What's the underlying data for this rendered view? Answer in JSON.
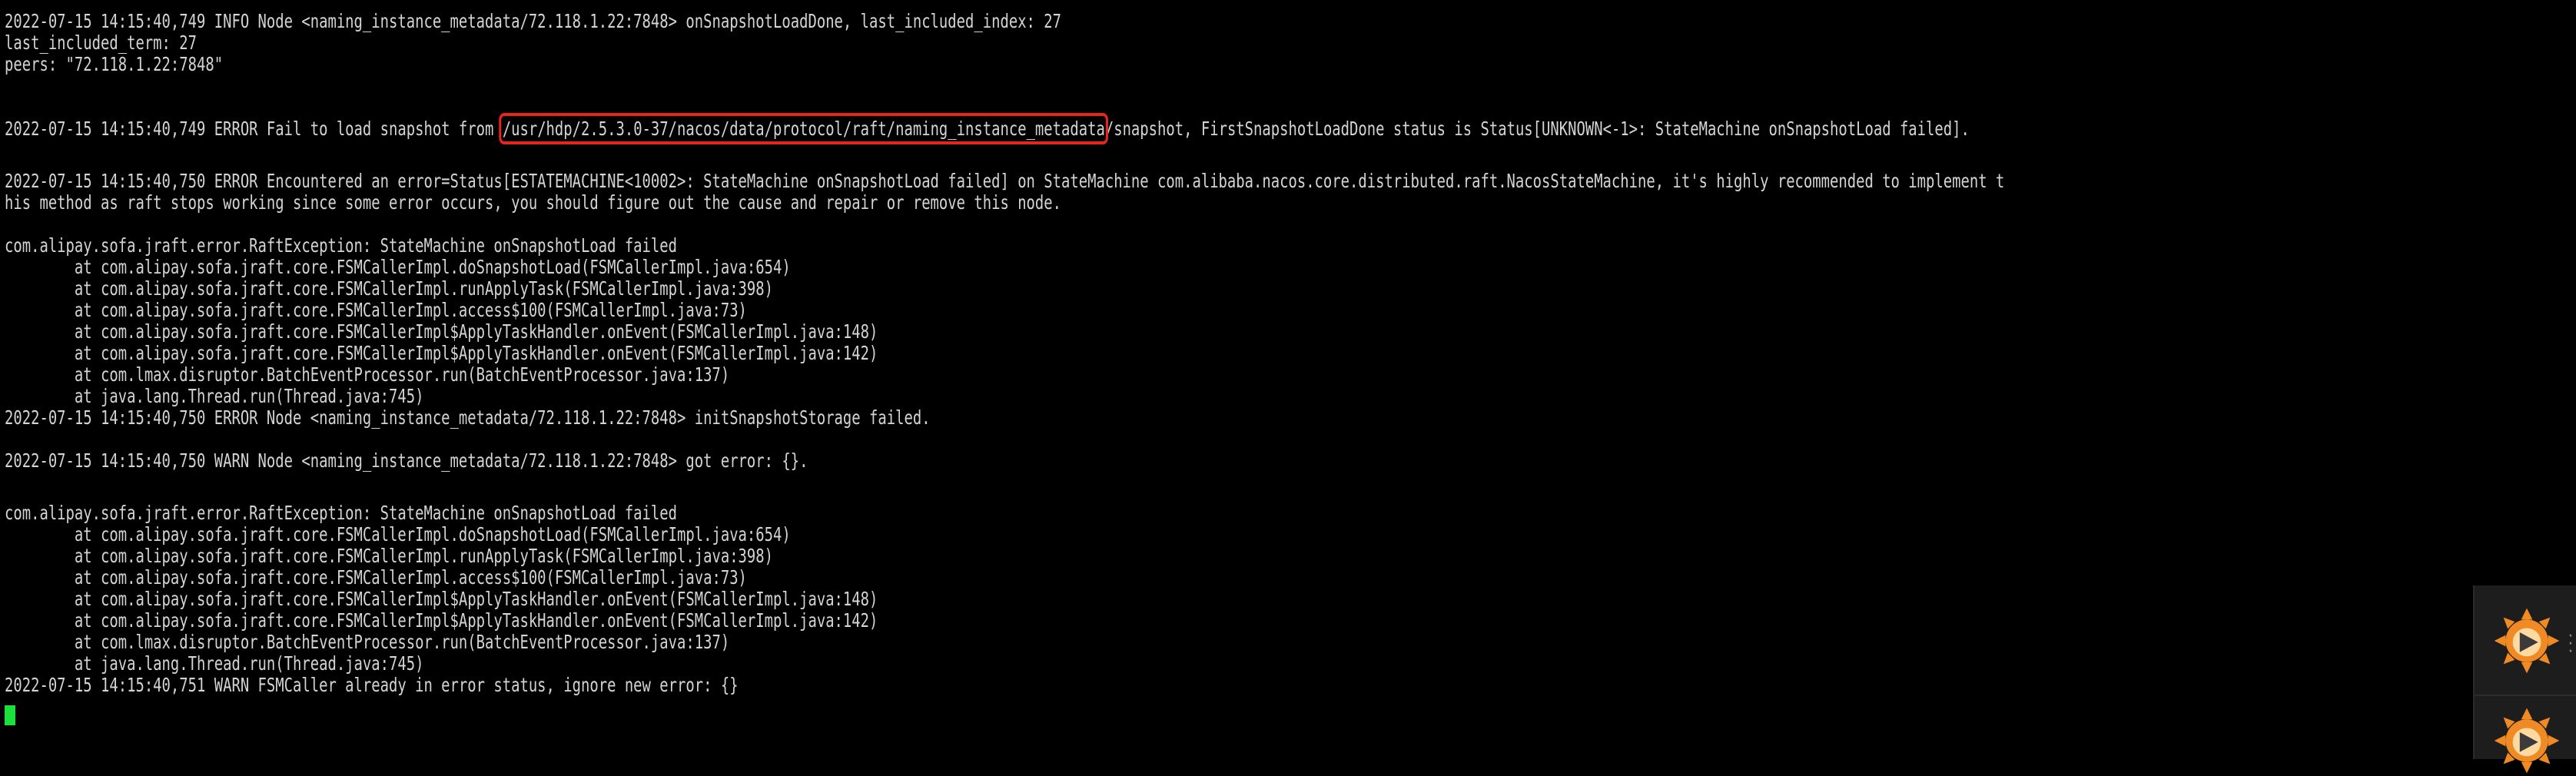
{
  "terminal": {
    "lines": [
      "2022-07-15 14:15:40,749 INFO Node <naming_instance_metadata/72.118.1.22:7848> onSnapshotLoadDone, last_included_index: 27",
      "last_included_term: 27",
      "peers: \"72.118.1.22:7848\"",
      "",
      "",
      "",
      "",
      "2022-07-15 14:15:40,750 ERROR Encountered an error=Status[ESTATEMACHINE<10002>: StateMachine onSnapshotLoad failed] on StateMachine com.alibaba.nacos.core.distributed.raft.NacosStateMachine, it's highly recommended to implement t",
      "his method as raft stops working since some error occurs, you should figure out the cause and repair or remove this node.",
      "",
      "com.alipay.sofa.jraft.error.RaftException: StateMachine onSnapshotLoad failed",
      "        at com.alipay.sofa.jraft.core.FSMCallerImpl.doSnapshotLoad(FSMCallerImpl.java:654)",
      "        at com.alipay.sofa.jraft.core.FSMCallerImpl.runApplyTask(FSMCallerImpl.java:398)",
      "        at com.alipay.sofa.jraft.core.FSMCallerImpl.access$100(FSMCallerImpl.java:73)",
      "        at com.alipay.sofa.jraft.core.FSMCallerImpl$ApplyTaskHandler.onEvent(FSMCallerImpl.java:148)",
      "        at com.alipay.sofa.jraft.core.FSMCallerImpl$ApplyTaskHandler.onEvent(FSMCallerImpl.java:142)",
      "        at com.lmax.disruptor.BatchEventProcessor.run(BatchEventProcessor.java:137)",
      "        at java.lang.Thread.run(Thread.java:745)",
      "2022-07-15 14:15:40,750 ERROR Node <naming_instance_metadata/72.118.1.22:7848> initSnapshotStorage failed.",
      "",
      "2022-07-15 14:15:40,750 WARN Node <naming_instance_metadata/72.118.1.22:7848> got error: {}.",
      "",
      "com.alipay.sofa.jraft.error.RaftException: StateMachine onSnapshotLoad failed",
      "        at com.alipay.sofa.jraft.core.FSMCallerImpl.doSnapshotLoad(FSMCallerImpl.java:654)",
      "        at com.alipay.sofa.jraft.core.FSMCallerImpl.runApplyTask(FSMCallerImpl.java:398)",
      "        at com.alipay.sofa.jraft.core.FSMCallerImpl.access$100(FSMCallerImpl.java:73)",
      "        at com.alipay.sofa.jraft.core.FSMCallerImpl$ApplyTaskHandler.onEvent(FSMCallerImpl.java:148)",
      "        at com.alipay.sofa.jraft.core.FSMCallerImpl$ApplyTaskHandler.onEvent(FSMCallerImpl.java:142)",
      "        at com.lmax.disruptor.BatchEventProcessor.run(BatchEventProcessor.java:137)",
      "        at java.lang.Thread.run(Thread.java:745)",
      "2022-07-15 14:15:40,751 WARN FSMCaller already in error status, ignore new error: {}"
    ],
    "error_line": {
      "prefix": "2022-07-15 14:15:40,749 ERROR Fail to load snapshot from ",
      "highlighted_path": "/usr/hdp/2.5.3.0-37/nacos/data/protocol/raft/naming_instance_metadata",
      "suffix": "/snapshot, FirstSnapshotLoadDone status is Status[UNKNOWN<-1>: StateMachine onSnapshotLoad failed]."
    },
    "colors": {
      "background": "#000000",
      "text": "#d4d4d4",
      "highlight_box": "#e8241b",
      "cursor": "#19e03a"
    }
  },
  "assistant_widget": {
    "icon": "mascot-icon",
    "more_icon": "more-vertical-icon"
  }
}
